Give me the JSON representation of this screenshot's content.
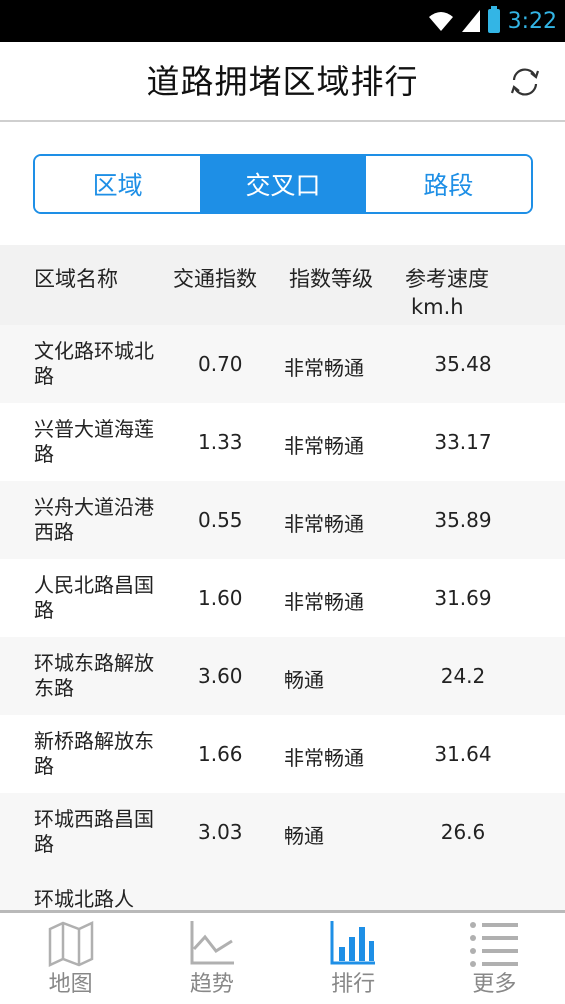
{
  "status_bar": {
    "time": "3:22",
    "icons": [
      "wifi-icon",
      "signal-icon",
      "battery-icon"
    ],
    "accent": "#33b5e5"
  },
  "app_bar": {
    "title": "道路拥堵区域排行",
    "refresh_icon": "refresh-icon"
  },
  "segments": {
    "items": [
      "区域",
      "交叉口",
      "路段"
    ],
    "selected": "交叉口",
    "accent": "#1e8fe6"
  },
  "table": {
    "headers": {
      "name": "区域名称",
      "index": "交通指数",
      "level": "指数等级",
      "speed": "参考速度",
      "speed_unit": "km.h"
    },
    "rows": [
      {
        "name": "文化路环城北路",
        "index": "0.70",
        "level": "非常畅通",
        "speed": "35.48"
      },
      {
        "name": "兴普大道海莲路",
        "index": "1.33",
        "level": "非常畅通",
        "speed": "33.17"
      },
      {
        "name": "兴舟大道沿港西路",
        "index": "0.55",
        "level": "非常畅通",
        "speed": "35.89"
      },
      {
        "name": "人民北路昌国路",
        "index": "1.60",
        "level": "非常畅通",
        "speed": "31.69"
      },
      {
        "name": "环城东路解放东路",
        "index": "3.60",
        "level": "畅通",
        "speed": "24.2"
      },
      {
        "name": "新桥路解放东路",
        "index": "1.66",
        "level": "非常畅通",
        "speed": "31.64"
      },
      {
        "name": "环城西路昌国路",
        "index": "3.03",
        "level": "畅通",
        "speed": "26.6"
      }
    ],
    "partial_row_name": "环城北路人"
  },
  "bottom_nav": {
    "items": [
      {
        "label": "地图",
        "icon": "map-icon"
      },
      {
        "label": "趋势",
        "icon": "trend-icon"
      },
      {
        "label": "排行",
        "icon": "ranking-icon"
      },
      {
        "label": "更多",
        "icon": "more-list-icon"
      }
    ],
    "selected": "排行",
    "active_color": "#1e8fe6",
    "inactive_color": "#b0b0b0"
  }
}
